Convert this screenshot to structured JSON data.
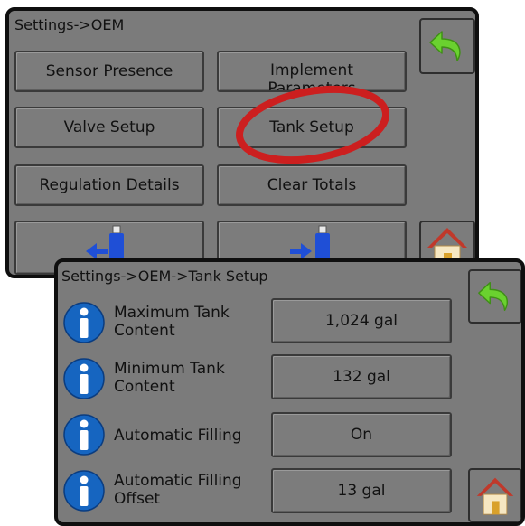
{
  "oem_screen": {
    "title": "Settings->OEM",
    "buttons": {
      "sensor_presence": "Sensor Presence",
      "implement_parameters": "Implement Parameters",
      "valve_setup": "Valve Setup",
      "tank_setup": "Tank Setup",
      "regulation_details": "Regulation Details",
      "clear_totals": "Clear Totals"
    },
    "usb_left_icon": "usb-import-icon",
    "usb_right_icon": "usb-export-icon",
    "back_icon": "back-arrow-icon",
    "home_icon": "home-icon"
  },
  "tank_screen": {
    "title": "Settings->OEM->Tank Setup",
    "rows": [
      {
        "label": "Maximum Tank Content",
        "value": "1,024 gal"
      },
      {
        "label": "Minimum Tank Content",
        "value": "132 gal"
      },
      {
        "label": "Automatic Filling",
        "value": "On"
      },
      {
        "label": "Automatic Filling Offset",
        "value": "13 gal"
      }
    ],
    "info_icon": "info-icon",
    "back_icon": "back-arrow-icon",
    "home_icon": "home-icon"
  },
  "colors": {
    "screen_bg": "#7b7b7b",
    "bezel": "#0f0f0f",
    "highlight_circle": "#cc1f1f",
    "back_arrow_green": "#6ad12f",
    "info_blue": "#1665c0",
    "usb_blue": "#1f4fd6"
  }
}
